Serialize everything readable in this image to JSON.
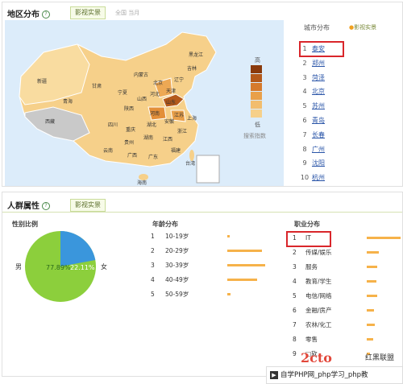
{
  "region": {
    "title": "地区分布",
    "tab_active": "影视实景",
    "tab_inactive": "全国 当月",
    "city_header": "城市分布",
    "city_tab": "影视实景",
    "legend_high": "高",
    "legend_low": "低",
    "legend_caption": "搜索指数",
    "cities": [
      {
        "rank": "1",
        "name": "泰安"
      },
      {
        "rank": "2",
        "name": "郑州"
      },
      {
        "rank": "3",
        "name": "菏泽"
      },
      {
        "rank": "4",
        "name": "北京"
      },
      {
        "rank": "5",
        "name": "苏州"
      },
      {
        "rank": "6",
        "name": "青岛"
      },
      {
        "rank": "7",
        "name": "长春"
      },
      {
        "rank": "8",
        "name": "广州"
      },
      {
        "rank": "9",
        "name": "沈阳"
      },
      {
        "rank": "10",
        "name": "杭州"
      }
    ],
    "provinces": [
      "新疆",
      "西藏",
      "青海",
      "甘肃",
      "宁夏",
      "内蒙古",
      "黑龙江",
      "吉林",
      "辽宁",
      "北京",
      "天津",
      "河北",
      "山西",
      "陕西",
      "山东",
      "河南",
      "江苏",
      "安徽",
      "湖北",
      "四川",
      "重庆",
      "上海",
      "浙江",
      "湖南",
      "江西",
      "贵州",
      "云南",
      "广西",
      "广东",
      "福建",
      "台湾",
      "海南"
    ]
  },
  "crowd": {
    "title": "人群属性",
    "tab": "影视实景",
    "gender": {
      "title": "性别比例",
      "male_label": "男",
      "female_label": "女",
      "male_pct": "77.89%",
      "female_pct": "22.11%",
      "female_fraction": 0.2211,
      "male_color": "#8ccf3c",
      "female_color": "#3a96dc"
    },
    "age": {
      "title": "年龄分布",
      "rows": [
        {
          "rank": "1",
          "label": "10-19岁",
          "value": 0.06
        },
        {
          "rank": "2",
          "label": "20-29岁",
          "value": 0.92
        },
        {
          "rank": "3",
          "label": "30-39岁",
          "value": 1.0
        },
        {
          "rank": "4",
          "label": "40-49岁",
          "value": 0.78
        },
        {
          "rank": "5",
          "label": "50-59岁",
          "value": 0.08
        }
      ]
    },
    "job": {
      "title": "职业分布",
      "rows": [
        {
          "rank": "1",
          "label": "IT",
          "value": 1.0
        },
        {
          "rank": "2",
          "label": "传媒/娱乐",
          "value": 0.35
        },
        {
          "rank": "3",
          "label": "服务",
          "value": 0.3
        },
        {
          "rank": "4",
          "label": "教育/学生",
          "value": 0.28
        },
        {
          "rank": "5",
          "label": "电信/网络",
          "value": 0.3
        },
        {
          "rank": "6",
          "label": "金融/房产",
          "value": 0.22
        },
        {
          "rank": "7",
          "label": "农林/化工",
          "value": 0.24
        },
        {
          "rank": "8",
          "label": "零售",
          "value": 0.18
        },
        {
          "rank": "9",
          "label": "□软",
          "value": 0.1
        }
      ]
    }
  },
  "watermark": {
    "logo_text": "红黑联盟",
    "footer": "自学PHP网_php学习_php教"
  },
  "colors": {
    "accent_green": "#5a6e2a",
    "link_blue": "#2a55a8",
    "highlight_red": "#d9262b",
    "bar_orange": "#f6b24a"
  }
}
